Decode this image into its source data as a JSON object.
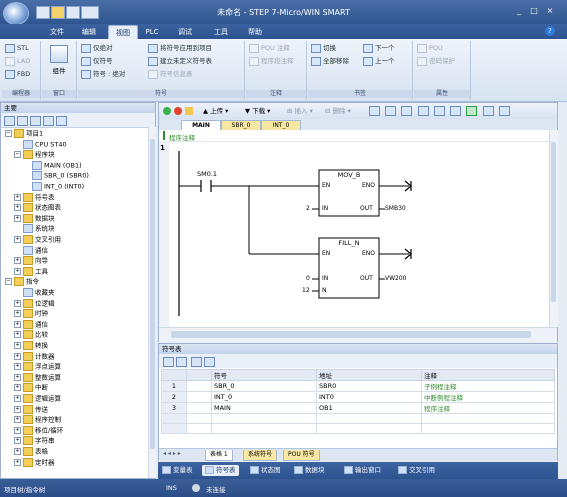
{
  "window": {
    "title": "未命名 - STEP 7-Micro/WIN SMART",
    "controls": [
      "_",
      "□",
      "×"
    ]
  },
  "menu_tabs": [
    "文件",
    "编辑",
    "视图",
    "PLC",
    "调试",
    "工具",
    "帮助"
  ],
  "active_tab_index": 2,
  "ribbon": {
    "groups": [
      {
        "label": "编程器",
        "items": [
          "STL",
          "LAD",
          "FBD"
        ]
      },
      {
        "label": "窗口",
        "items": [
          "组件"
        ]
      },
      {
        "label": "符号",
        "items": [
          "将符号应用到项目",
          "建立未定义符号表",
          "符号信息表"
        ],
        "side_items": [
          "仅绝对",
          "仅符号",
          "符号 : 绝对"
        ]
      },
      {
        "label": "注释",
        "items": [
          "POU 注释",
          "程序段注释"
        ]
      },
      {
        "label": "书签",
        "items": [
          "切换",
          "全部移除",
          "下一个",
          "上一个"
        ]
      },
      {
        "label": "属性",
        "items": [
          "POU",
          "密码保护"
        ]
      }
    ]
  },
  "project_tree": {
    "header": "主要",
    "nodes": [
      {
        "label": "项目1",
        "level": 0,
        "expanded": true
      },
      {
        "label": "CPU ST40",
        "level": 1
      },
      {
        "label": "程序块",
        "level": 1,
        "expanded": true
      },
      {
        "label": "MAIN (OB1)",
        "level": 2
      },
      {
        "label": "SBR_0 (SBR0)",
        "level": 2
      },
      {
        "label": "INT_0 (INT0)",
        "level": 2
      },
      {
        "label": "符号表",
        "level": 1,
        "expanded": false
      },
      {
        "label": "状态图表",
        "level": 1,
        "expanded": false
      },
      {
        "label": "数据块",
        "level": 1,
        "expanded": false
      },
      {
        "label": "系统块",
        "level": 1
      },
      {
        "label": "交叉引用",
        "level": 1,
        "expanded": false
      },
      {
        "label": "通信",
        "level": 1
      },
      {
        "label": "向导",
        "level": 1,
        "expanded": false
      },
      {
        "label": "工具",
        "level": 1,
        "expanded": false
      },
      {
        "label": "指令",
        "level": 0,
        "expanded": true
      },
      {
        "label": "收藏夹",
        "level": 1
      },
      {
        "label": "位逻辑",
        "level": 1,
        "expanded": false
      },
      {
        "label": "时钟",
        "level": 1,
        "expanded": false
      },
      {
        "label": "通信",
        "level": 1,
        "expanded": false
      },
      {
        "label": "比较",
        "level": 1,
        "expanded": false
      },
      {
        "label": "转换",
        "level": 1,
        "expanded": false
      },
      {
        "label": "计数器",
        "level": 1,
        "expanded": false
      },
      {
        "label": "浮点运算",
        "level": 1,
        "expanded": false
      },
      {
        "label": "整数运算",
        "level": 1,
        "expanded": false
      },
      {
        "label": "中断",
        "level": 1,
        "expanded": false
      },
      {
        "label": "逻辑运算",
        "level": 1,
        "expanded": false
      },
      {
        "label": "传送",
        "level": 1,
        "expanded": false
      },
      {
        "label": "程序控制",
        "level": 1,
        "expanded": false
      },
      {
        "label": "移位/循环",
        "level": 1,
        "expanded": false
      },
      {
        "label": "字符串",
        "level": 1,
        "expanded": false
      },
      {
        "label": "表格",
        "level": 1,
        "expanded": false
      },
      {
        "label": "定时器",
        "level": 1,
        "expanded": false
      }
    ]
  },
  "editor": {
    "toolbar": [
      "上传",
      "下载",
      "插入",
      "删除"
    ],
    "tabs": [
      "MAIN",
      "SBR_0",
      "INT_0"
    ],
    "active_tab": "MAIN",
    "program_comment": "程序注释",
    "network_number": "1",
    "contact": "SM0.1",
    "blocks": [
      {
        "name": "MOV_B",
        "en": "EN",
        "eno": "ENO",
        "in_label": "IN",
        "out_label": "OUT",
        "in_value": "2",
        "out_value": "SMB30"
      },
      {
        "name": "FILL_N",
        "en": "EN",
        "eno": "ENO",
        "in_label": "IN",
        "out_label": "OUT",
        "n_label": "N",
        "in_value": "0",
        "n_value": "12",
        "out_value": "VW200"
      }
    ]
  },
  "symbol_table": {
    "header": "符号表",
    "columns": [
      "",
      "",
      "符号",
      "地址",
      "注释"
    ],
    "rows": [
      {
        "index": "1",
        "symbol": "SBR_0",
        "address": "SBR0",
        "comment": "子例程注释"
      },
      {
        "index": "2",
        "symbol": "INT_0",
        "address": "INT0",
        "comment": "中断例程注释"
      },
      {
        "index": "3",
        "symbol": "MAIN",
        "address": "OB1",
        "comment": "程序注释"
      }
    ],
    "tabs": [
      "表格 1",
      "系统符号",
      "POU 符号"
    ]
  },
  "dock_tabs": [
    "变量表",
    "符号表",
    "状态图",
    "数据块",
    "输出窗口",
    "交叉引用"
  ],
  "dock_active_index": 1,
  "status": {
    "left": "项目树/指令树",
    "mode": "INS",
    "connection": "未连接"
  }
}
